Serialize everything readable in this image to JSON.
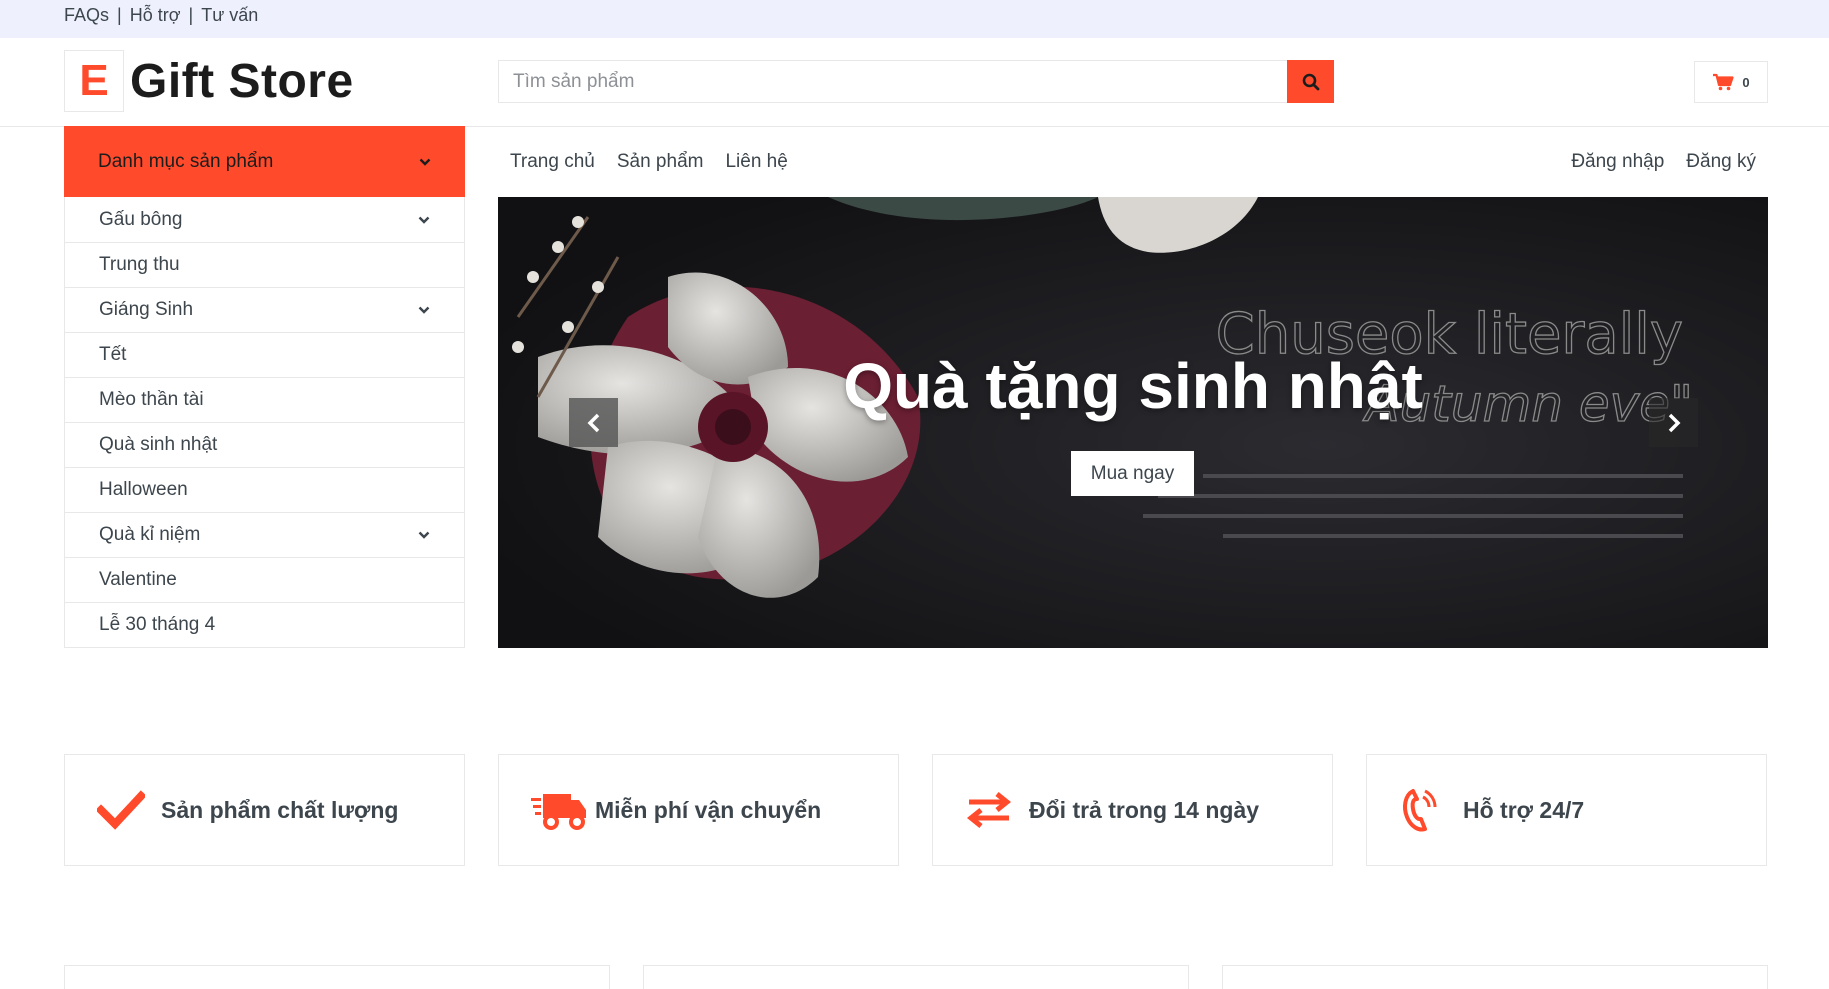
{
  "colors": {
    "accent": "#ff4b2b",
    "topbar_bg": "#eef1fd",
    "text": "#3d464d"
  },
  "topbar": {
    "links": [
      "FAQs",
      "Hỗ trợ",
      "Tư vấn"
    ],
    "separator": "|"
  },
  "logo": {
    "mark": "E",
    "text": "Gift Store"
  },
  "search": {
    "placeholder": "Tìm sản phẩm",
    "button_icon": "search-icon"
  },
  "cart": {
    "icon": "shopping-cart-icon",
    "count": "0"
  },
  "categories": {
    "header_label": "Danh mục sản phẩm",
    "items": [
      {
        "label": "Gấu bông",
        "has_submenu": true
      },
      {
        "label": "Trung thu",
        "has_submenu": false
      },
      {
        "label": "Giáng Sinh",
        "has_submenu": true
      },
      {
        "label": "Tết",
        "has_submenu": false
      },
      {
        "label": "Mèo thần tài",
        "has_submenu": false
      },
      {
        "label": "Quà sinh nhật",
        "has_submenu": false
      },
      {
        "label": "Halloween",
        "has_submenu": false
      },
      {
        "label": "Quà kỉ niệm",
        "has_submenu": true
      },
      {
        "label": "Valentine",
        "has_submenu": false
      },
      {
        "label": "Lễ 30 tháng 4",
        "has_submenu": false
      }
    ]
  },
  "nav": {
    "left": [
      "Trang chủ",
      "Sản phẩm",
      "Liên hệ"
    ],
    "right": [
      "Đăng nhập",
      "Đăng ký"
    ]
  },
  "banner": {
    "title": "Quà tặng sinh nhật",
    "button_label": "Mua ngay",
    "image_text_line1": "Chuseok literally",
    "image_text_line2": "Autumn eve\"",
    "prev_icon": "chevron-left-icon",
    "next_icon": "chevron-right-icon"
  },
  "features": [
    {
      "icon": "checkmark-icon",
      "label": "Sản phẩm chất lượng"
    },
    {
      "icon": "shipping-truck-icon",
      "label": "Miễn phí vận chuyển"
    },
    {
      "icon": "exchange-arrows-icon",
      "label": "Đổi trả trong 14 ngày"
    },
    {
      "icon": "phone-icon",
      "label": "Hỗ trợ 24/7"
    }
  ]
}
